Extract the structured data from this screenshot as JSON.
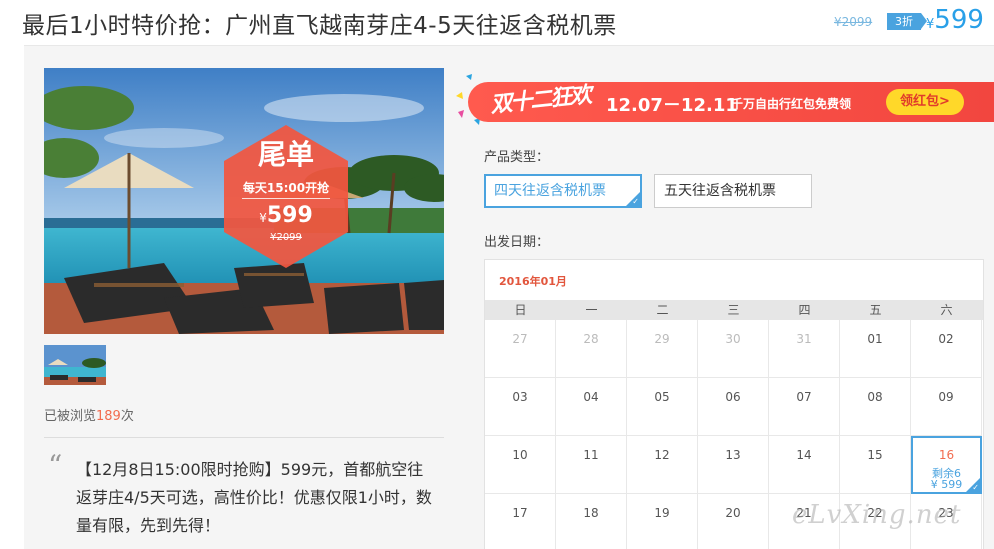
{
  "header": {
    "title": "最后1小时特价抢：广州直飞越南芽庄4-5天往返含税机票",
    "price_old": "¥2099",
    "discount": "3折",
    "price_currency": "¥",
    "price_now": "599"
  },
  "hero": {
    "badge_title": "尾单",
    "badge_sub": "每天15:00开抢",
    "badge_currency": "¥",
    "badge_price": "599",
    "badge_old_price": "¥2099"
  },
  "views": {
    "prefix": "已被浏览",
    "count": "189",
    "suffix": "次"
  },
  "description": "【12月8日15:00限时抢购】599元，首都航空往返芽庄4/5天可选，高性价比！优惠仅限1小时，数量有限，先到先得！",
  "promo": {
    "logo": "双十二狂欢",
    "dates": "12.07－12.11",
    "text": "千万自由行红包免费领",
    "button": "领红包>"
  },
  "product_type": {
    "label": "产品类型：",
    "options": [
      "四天往返含税机票",
      "五天往返含税机票"
    ],
    "selected": 0
  },
  "departure": {
    "label": "出发日期："
  },
  "calendar": {
    "month": "2016年01月",
    "weekdays": [
      "日",
      "一",
      "二",
      "三",
      "四",
      "五",
      "六"
    ],
    "rows": [
      [
        "27",
        "28",
        "29",
        "30",
        "31",
        "01",
        "02"
      ],
      [
        "03",
        "04",
        "05",
        "06",
        "07",
        "08",
        "09"
      ],
      [
        "10",
        "11",
        "12",
        "13",
        "14",
        "15",
        "16"
      ],
      [
        "17",
        "18",
        "19",
        "20",
        "21",
        "22",
        "23"
      ]
    ],
    "other_month_days": [
      "27",
      "28",
      "29",
      "30",
      "31"
    ],
    "available": {
      "day": "16",
      "remaining": "剩余6",
      "price": "¥ 599"
    }
  },
  "watermark": "eLvXing.net",
  "colors": {
    "accent_blue": "#4aa3df",
    "price_red": "#f26c4f",
    "promo_red": "#f2463f",
    "promo_yellow": "#ffd829"
  }
}
